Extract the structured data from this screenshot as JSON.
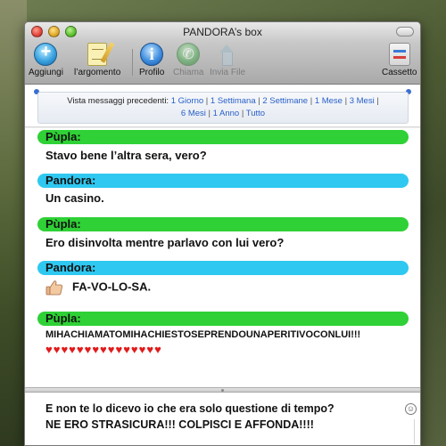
{
  "window": {
    "title": "PANDORA’s box"
  },
  "toolbar": {
    "add_label": "Aggiungi",
    "topic_label": "l’argomento",
    "profile_label": "Profilo",
    "call_label": "Chiama",
    "sendfile_label": "Invia File",
    "drawer_label": "Cassetto"
  },
  "history": {
    "prefix": "Vista messaggi precedenti:",
    "links": [
      "1 Giorno",
      "1 Settimana",
      "2 Settimane",
      "1 Mese",
      "3 Mesi",
      "6 Mesi",
      "1 Anno",
      "Tutto"
    ]
  },
  "messages": [
    {
      "sender": "Pùpla",
      "text": "Stavo bene l’altra sera, vero?",
      "color": "#2fd136"
    },
    {
      "sender": "Pandora",
      "text": "Un casino.",
      "color": "#2fc8f1"
    },
    {
      "sender": "Pùpla",
      "text": "Ero disinvolta mentre parlavo con lui vero?",
      "color": "#2fd136"
    },
    {
      "sender": "Pandora",
      "text": "FA-VO-LO-SA.",
      "icon": "thumbs-up-icon",
      "color": "#2fc8f1"
    },
    {
      "sender": "Pùpla",
      "text": "MIHACHIAMATOMIHACHIESTOSEPRENDOUNAPERITIVOCONLUI!!!",
      "hearts": "♥♥♥♥♥♥♥♥♥♥♥♥♥♥♥",
      "color": "#2fd136"
    }
  ],
  "compose": {
    "line1": "E non te lo dicevo io che era solo questione di tempo?",
    "line2": "NE ERO STRASICURA!!! COLPISCI E AFFONDA!!!!"
  },
  "colors": {
    "green_header": "#2fd136",
    "cyan_header": "#2fc8f1",
    "link": "#2a60c8",
    "heart": "#e11b1b"
  }
}
